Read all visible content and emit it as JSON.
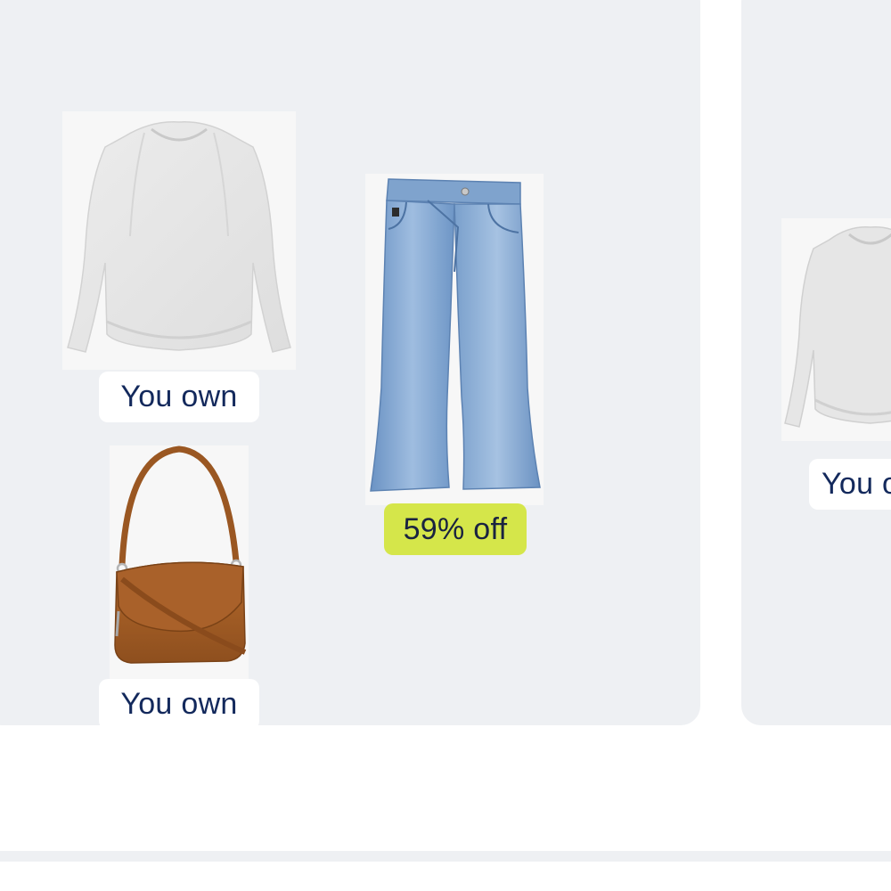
{
  "outfits": [
    {
      "items": [
        {
          "name": "Heather knit long-sleeve top",
          "badge": "You own",
          "badge_type": "owned"
        },
        {
          "name": "Light wash flare jeans",
          "badge": "59% off",
          "badge_type": "sale"
        },
        {
          "name": "Cognac crossbody bag",
          "badge": "You own",
          "badge_type": "owned"
        }
      ]
    },
    {
      "items": [
        {
          "name": "Heather knit long-sleeve top",
          "badge": "You own",
          "badge_type": "owned"
        }
      ]
    }
  ],
  "colors": {
    "card_background": "#eef0f3",
    "badge_text": "#13295c",
    "sale_badge_background": "#d5e64a",
    "page_background": "#ffffff"
  },
  "icons": {
    "top": "sweater-icon",
    "jeans": "jeans-icon",
    "bag": "handbag-icon"
  }
}
